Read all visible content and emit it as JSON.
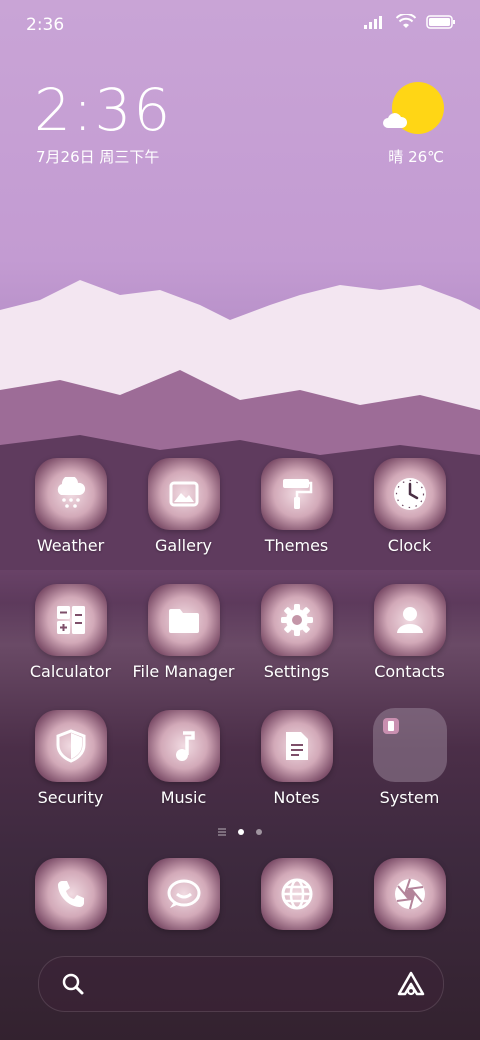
{
  "status_bar": {
    "time": "2:36"
  },
  "clock_widget": {
    "time": "2:36",
    "date": "7月26日 周三下午"
  },
  "weather_widget": {
    "condition_temp": "晴 26℃"
  },
  "apps": [
    {
      "label": "Weather",
      "icon": "cloud-snow-icon"
    },
    {
      "label": "Gallery",
      "icon": "image-icon"
    },
    {
      "label": "Themes",
      "icon": "paint-roller-icon"
    },
    {
      "label": "Clock",
      "icon": "clock-icon"
    },
    {
      "label": "Calculator",
      "icon": "calculator-icon"
    },
    {
      "label": "File Manager",
      "icon": "folder-icon"
    },
    {
      "label": "Settings",
      "icon": "gear-icon"
    },
    {
      "label": "Contacts",
      "icon": "person-icon"
    },
    {
      "label": "Security",
      "icon": "shield-icon"
    },
    {
      "label": "Music",
      "icon": "music-note-icon"
    },
    {
      "label": "Notes",
      "icon": "note-icon"
    },
    {
      "label": "System",
      "icon": "folder-icon"
    }
  ],
  "page_indicator": {
    "pages": 2,
    "active": 1
  },
  "dock": [
    {
      "icon": "phone-icon"
    },
    {
      "icon": "message-icon"
    },
    {
      "icon": "browser-globe-icon"
    },
    {
      "icon": "camera-aperture-icon"
    }
  ],
  "search": {
    "icon": "search-icon",
    "assistant_icon": "assistant-icon"
  }
}
